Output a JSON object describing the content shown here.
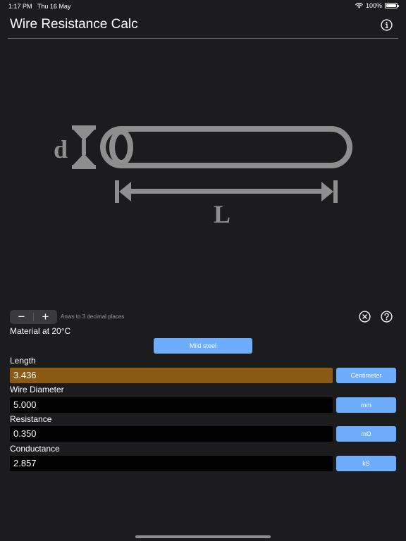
{
  "status_bar": {
    "time": "1:17 PM",
    "date": "Thu 16 May",
    "battery": "100%",
    "battery_level": 1.0
  },
  "header": {
    "title": "Wire Resistance Calc",
    "info_icon": "info-circle-icon"
  },
  "diagram": {
    "diameter_label": "d",
    "length_label": "L",
    "color": "#8e8e8e"
  },
  "controls": {
    "decrement": "−",
    "increment": "+",
    "precision_text": "Anws to 3 decimal places",
    "clear_icon": "close-circle-icon",
    "help_icon": "question-circle-icon"
  },
  "material": {
    "label": "Material at 20°C",
    "button": "Mild steel"
  },
  "fields": [
    {
      "label": "Length",
      "value": "3.436",
      "unit": "Centimeter",
      "active": true
    },
    {
      "label": "Wire Diameter",
      "value": "5.000",
      "unit": "mm",
      "active": false
    },
    {
      "label": "Resistance",
      "value": "0.350",
      "unit": "mΩ",
      "active": false
    },
    {
      "label": "Conductance",
      "value": "2.857",
      "unit": "kS",
      "active": false
    }
  ],
  "colors": {
    "accent": "#6eadfb",
    "active_field": "#8b5a14",
    "background": "#1c1c1e"
  }
}
